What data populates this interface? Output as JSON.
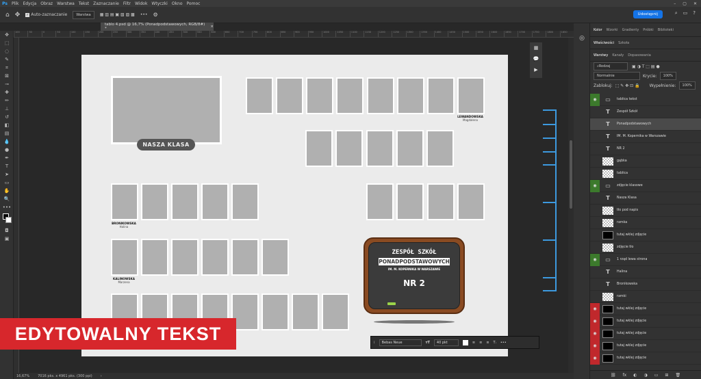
{
  "app": {
    "logo": "Ps"
  },
  "menu": [
    "Plik",
    "Edycja",
    "Obraz",
    "Warstwa",
    "Tekst",
    "Zaznaczanie",
    "Filtr",
    "Widok",
    "Wtyczki",
    "Okno",
    "Pomoc"
  ],
  "options": {
    "auto_select_label": "Auto-zaznaczanie",
    "target": "Warstwa",
    "share_button": "Udostępnij"
  },
  "document_tab": {
    "title": "tablo 4.psd @ 16,7% (Ponadpodstawowych, RGB/8#) *"
  },
  "ruler_ticks": [
    "100",
    "50",
    "0",
    "50",
    "100",
    "150",
    "200",
    "250",
    "300",
    "350",
    "400",
    "450",
    "500",
    "550",
    "600",
    "650",
    "700",
    "750",
    "800",
    "850",
    "900",
    "950",
    "1000",
    "1050",
    "1100",
    "1150",
    "1200",
    "1250",
    "1300",
    "1350",
    "1400",
    "1450",
    "1500",
    "1550",
    "1600",
    "1650",
    "1700",
    "1750",
    "1800",
    "1850",
    "1900",
    "1950",
    "2000",
    "2050",
    "2100",
    "2150",
    "2200",
    "2250",
    "2300",
    "2350",
    "2400",
    "2450",
    "2500",
    "2550",
    "2600",
    "2650",
    "2700",
    "2750",
    "2800",
    "2850",
    "2900",
    "2950",
    "3000",
    "3050",
    "3100",
    "3150",
    "3200",
    "3250",
    "3300",
    "3350",
    "3400",
    "3450",
    "3500",
    "3550",
    "3600",
    "3650",
    "3700",
    "3750",
    "3800",
    "3850",
    "3900",
    "3950",
    "4000",
    "4050",
    "4100",
    "4150",
    "4200",
    "4250",
    "4300",
    "4350",
    "4400",
    "4450",
    "4500",
    "4550",
    "4600",
    "4650",
    "4700",
    "4750",
    "4800",
    "4850",
    "4900",
    "4950",
    "5000",
    "5050",
    "5100",
    "5150",
    "5200",
    "5250",
    "5300",
    "5350",
    "5400",
    "5450",
    "5500",
    "5550",
    "5600"
  ],
  "document": {
    "class_pill": "NASZA KLASA",
    "names": [
      {
        "last": "LEWANDOWSKA",
        "first": "Magdalena"
      },
      {
        "last": "BRONIKOWSKA",
        "first": "Halina"
      },
      {
        "last": "KALINOWSKA",
        "first": "Marzena"
      }
    ],
    "board": {
      "line1": "ZESPÓŁ SZKÓŁ",
      "line2": "PONADPODSTAWOWYCH",
      "line3": "IM. M. KOPERNIKA W WARSZAWIE",
      "line4": "NR 2"
    }
  },
  "banner": "EDYTOWALNY TEKST",
  "text_toolbar": {
    "font": "Bebas Neue",
    "size": "40 pkt"
  },
  "status": {
    "zoom": "16,67%",
    "info": "7016 pks. x 4961 pks. (300 ppi)"
  },
  "panel": {
    "top_tabs": [
      "Kolor",
      "Wzorki",
      "Gradienty",
      "Próbki",
      "Biblioteki"
    ],
    "mid_tabs": [
      "Właściwości",
      "Szkoła"
    ],
    "layer_tabs": [
      "Warstwy",
      "Kanały",
      "Dopasowania"
    ],
    "search": "Rodzaj",
    "blend": "Normalnie",
    "opacity_label": "Krycie:",
    "opacity": "100%",
    "lock_label": "Zablokuj:",
    "fill_label": "Wypełnienie:",
    "fill": "100%",
    "layers": [
      {
        "name": "tablica tekst",
        "kind": "fold",
        "eye": "green"
      },
      {
        "name": "Zespół Szkół",
        "kind": "txt",
        "eye": "none"
      },
      {
        "name": "Ponadpodstawowych",
        "kind": "txt",
        "eye": "none",
        "selected": true
      },
      {
        "name": "IM. M. Kopernika w Warszawie",
        "kind": "txt",
        "eye": "none"
      },
      {
        "name": "NR 2",
        "kind": "txt",
        "eye": "none"
      },
      {
        "name": "gąbka",
        "kind": "chk",
        "eye": "none"
      },
      {
        "name": "tablica",
        "kind": "chk",
        "eye": "none"
      },
      {
        "name": "zdjęcie klasowe",
        "kind": "fold",
        "eye": "green"
      },
      {
        "name": "Nasza Klasa",
        "kind": "txt",
        "eye": "none"
      },
      {
        "name": "tło pod napis",
        "kind": "chk",
        "eye": "none"
      },
      {
        "name": "ramka",
        "kind": "chk",
        "eye": "none"
      },
      {
        "name": "tutaj wklej zdjęcie",
        "kind": "blk",
        "eye": "none"
      },
      {
        "name": "zdjęcie tło",
        "kind": "chk",
        "eye": "none"
      },
      {
        "name": "1 rząd lewa strona",
        "kind": "fold",
        "eye": "green"
      },
      {
        "name": "Halina",
        "kind": "txt",
        "eye": "none"
      },
      {
        "name": "Bronikowska",
        "kind": "txt",
        "eye": "none"
      },
      {
        "name": "ramki",
        "kind": "chk",
        "eye": "none"
      },
      {
        "name": "tutaj wklej zdjęcie",
        "kind": "blk",
        "eye": "red"
      },
      {
        "name": "tutaj wklej zdjęcie",
        "kind": "blk",
        "eye": "red"
      },
      {
        "name": "tutaj wklej zdjęcie",
        "kind": "blk",
        "eye": "red"
      },
      {
        "name": "tutaj wklej zdjęcie",
        "kind": "blk",
        "eye": "red"
      },
      {
        "name": "tutaj wklej zdjęcie",
        "kind": "blk",
        "eye": "red"
      }
    ]
  },
  "colors": {
    "accent": "#1473e6",
    "banner": "#d7272c",
    "eye_green": "#3c7a2c",
    "eye_red": "#c0282c",
    "guides": "#3d9ae0"
  }
}
